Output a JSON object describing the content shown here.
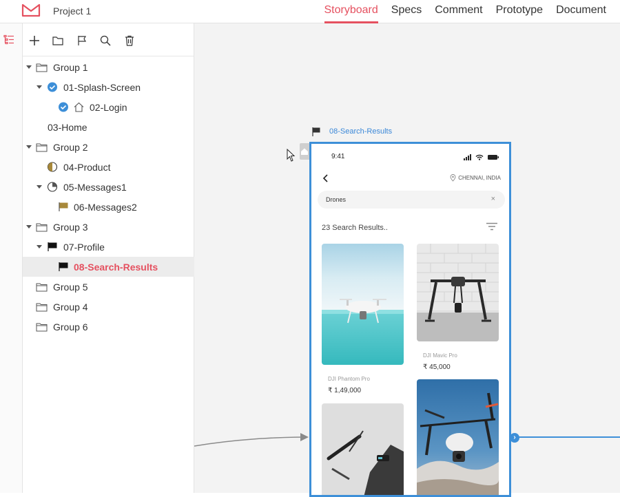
{
  "app": {
    "project_title": "Project 1",
    "brand_color": "#e5505f",
    "accent_color": "#3d8fd8"
  },
  "tabs": [
    {
      "label": "Storyboard",
      "active": true
    },
    {
      "label": "Specs",
      "active": false
    },
    {
      "label": "Comment",
      "active": false
    },
    {
      "label": "Prototype",
      "active": false
    },
    {
      "label": "Document",
      "active": false
    }
  ],
  "toolbar": {
    "icons": [
      "add-icon",
      "folder-icon",
      "flag-icon",
      "search-icon",
      "trash-icon"
    ]
  },
  "tree": [
    {
      "label": "Group 1",
      "icon": "folder-icon",
      "caret": true,
      "level": 0
    },
    {
      "label": "01-Splash-Screen",
      "icon": "check-circle-icon",
      "caret": true,
      "level": 1
    },
    {
      "label": "02-Login",
      "icon": "check-home-icon",
      "caret": false,
      "level": 2
    },
    {
      "label": "03-Home",
      "icon": "",
      "caret": false,
      "level": 1
    },
    {
      "label": "Group 2",
      "icon": "folder-icon",
      "caret": true,
      "level": 0
    },
    {
      "label": "04-Product",
      "icon": "half-circle-icon",
      "caret": false,
      "level": 1
    },
    {
      "label": "05-Messages1",
      "icon": "quarter-circle-icon",
      "caret": true,
      "level": 1
    },
    {
      "label": "06-Messages2",
      "icon": "flag-gold-icon",
      "caret": false,
      "level": 2
    },
    {
      "label": "Group 3",
      "icon": "folder-icon",
      "caret": true,
      "level": 0
    },
    {
      "label": "07-Profile",
      "icon": "flag-black-icon",
      "caret": true,
      "level": 1
    },
    {
      "label": "08-Search-Results",
      "icon": "flag-black-icon",
      "caret": false,
      "level": 2,
      "selected": true
    },
    {
      "label": "Group 5",
      "icon": "folder-icon",
      "caret": false,
      "level": 0
    },
    {
      "label": "Group 4",
      "icon": "folder-icon",
      "caret": false,
      "level": 0
    },
    {
      "label": "Group 6",
      "icon": "folder-icon",
      "caret": false,
      "level": 0
    }
  ],
  "artboard": {
    "label": "08-Search-Results"
  },
  "phone": {
    "time": "9:41",
    "location": "CHENNAI, INDIA",
    "search_value": "Drones",
    "search_clear": "×",
    "results_count": "23 Search Results..",
    "products": [
      {
        "name": "DJI Phantom Pro",
        "price": "₹ 1,49,000"
      },
      {
        "name": "DJI Mavic Pro",
        "price": "₹ 45,000"
      }
    ]
  }
}
